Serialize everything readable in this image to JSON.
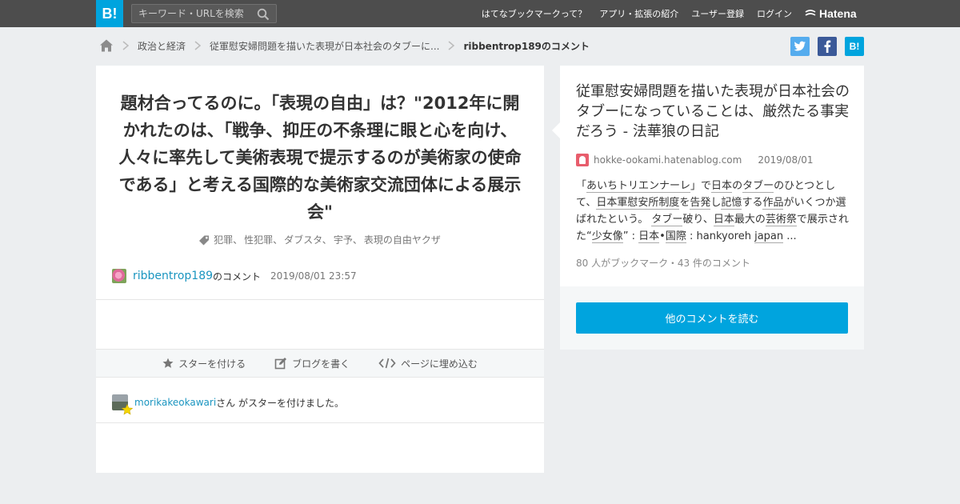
{
  "topbar": {
    "logo": "B!",
    "search_placeholder": "キーワード・URLを検索",
    "nav": [
      "はてなブックマークって？",
      "アプリ・拡張の紹介",
      "ユーザー登録",
      "ログイン"
    ],
    "brand": "Hatena"
  },
  "breadcrumb": {
    "items": [
      "政治と経済",
      "従軍慰安婦問題を描いた表現が日本社会のタブーに..."
    ],
    "current": "ribbentrop189のコメント"
  },
  "share": {
    "hatena_label": "B!"
  },
  "comment": {
    "text": "題材合ってるのに。「表現の自由」は？\"2012年に開かれたのは、「戦争、抑圧の不条理に眼と心を向け、人々に率先して美術表現で提示するのが美術家の使命である」と考える国際的な美術家交流団体による展示会\"",
    "tags": [
      "犯罪、",
      "性犯罪、",
      "ダブスタ、",
      "宇予、",
      "表現の自由ヤクザ"
    ],
    "author": "ribbentrop189",
    "author_suffix": "のコメント",
    "date": "2019/08/01 23:57"
  },
  "actions": {
    "star": "スターを付ける",
    "blog": "ブログを書く",
    "embed": "ページに埋め込む"
  },
  "star": {
    "user": "morikakeokawari",
    "suffix": "さん がスターを付けました。"
  },
  "entry": {
    "title": "従軍慰安婦問題を描いた表現が日本社会のタブーになっていることは、厳然たる事実だろう - 法華狼の日記",
    "domain": "hokke-ookami.hatenablog.com",
    "date": "2019/08/01",
    "desc_parts": [
      {
        "t": "「",
        "kw": false
      },
      {
        "t": "あいちトリエンナーレ",
        "kw": true
      },
      {
        "t": "」で",
        "kw": false
      },
      {
        "t": "日本",
        "kw": true
      },
      {
        "t": "の",
        "kw": false
      },
      {
        "t": "タブー",
        "kw": true
      },
      {
        "t": "のひとつとして、",
        "kw": false
      },
      {
        "t": "日本軍慰安所制度",
        "kw": true
      },
      {
        "t": "を",
        "kw": false
      },
      {
        "t": "告発",
        "kw": true
      },
      {
        "t": "し",
        "kw": false
      },
      {
        "t": "記憶",
        "kw": true
      },
      {
        "t": "する",
        "kw": false
      },
      {
        "t": "作品",
        "kw": true
      },
      {
        "t": "がいくつか選ばれたという。 ",
        "kw": false
      },
      {
        "t": "タブー",
        "kw": true
      },
      {
        "t": "破り、",
        "kw": false
      },
      {
        "t": "日本",
        "kw": true
      },
      {
        "t": "最大の",
        "kw": false
      },
      {
        "t": "芸術祭",
        "kw": true
      },
      {
        "t": "で展示された“",
        "kw": false
      },
      {
        "t": "少女像",
        "kw": true
      },
      {
        "t": "” : ",
        "kw": false
      },
      {
        "t": "日本",
        "kw": true
      },
      {
        "t": "•",
        "kw": false
      },
      {
        "t": "国際",
        "kw": true
      },
      {
        "t": " : hankyoreh ",
        "kw": false
      },
      {
        "t": "japan",
        "kw": true
      },
      {
        "t": " ...",
        "kw": false
      }
    ],
    "stats": "80 人がブックマーク・43 件のコメント",
    "read_button": "他のコメントを読む"
  }
}
